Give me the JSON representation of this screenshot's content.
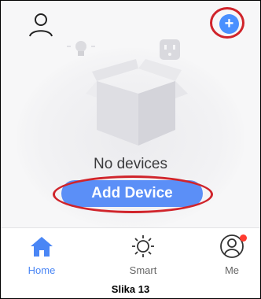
{
  "empty_state": {
    "message": "No devices",
    "button_label": "Add Device"
  },
  "header": {
    "left_icon": "profile-icon",
    "right_icon": "plus-icon"
  },
  "tabs": [
    {
      "label": "Home",
      "icon": "home-icon",
      "active": true
    },
    {
      "label": "Smart",
      "icon": "sun-icon",
      "active": false
    },
    {
      "label": "Me",
      "icon": "user-circle-icon",
      "active": false,
      "notification_dot": true
    }
  ],
  "caption": "Slika 13",
  "colors": {
    "accent": "#4a86f5",
    "button": "#5b8ff7",
    "highlight_ring": "#d0242b",
    "badge": "#ff3b30"
  }
}
